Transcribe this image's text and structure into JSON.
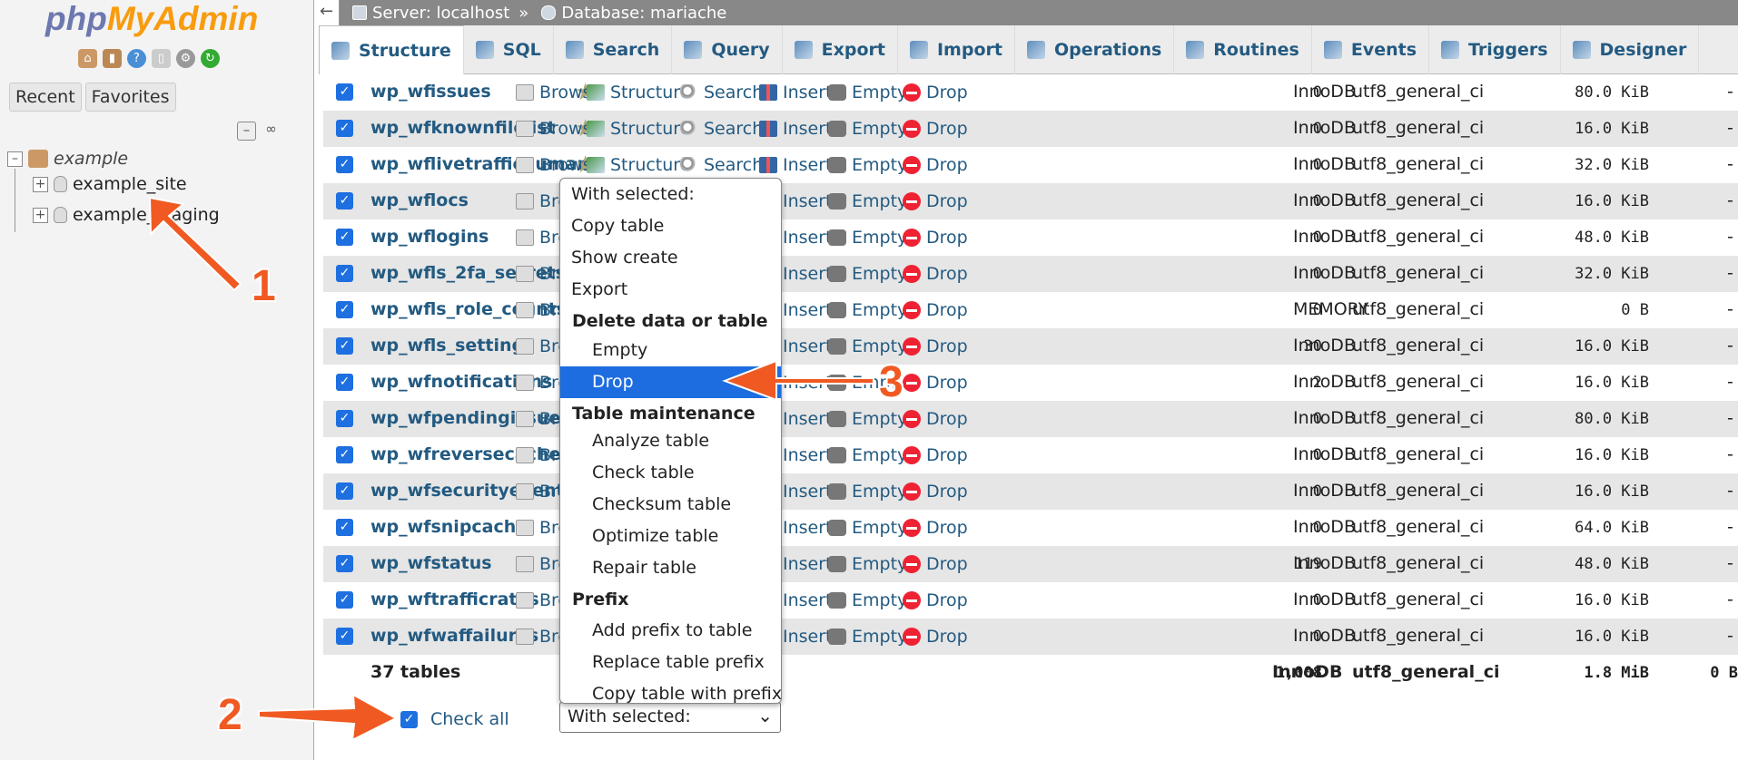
{
  "app": {
    "logo_main": "php",
    "logo_accent": "MyAdmin"
  },
  "left": {
    "tabs": [
      "Recent",
      "Favorites"
    ],
    "tree": {
      "root": "example",
      "children": [
        "example_site",
        "example_staging"
      ]
    }
  },
  "breadcrumb": {
    "back": "←",
    "server": "Server: localhost",
    "separator": "»",
    "database": "Database: mariache"
  },
  "menu": [
    "Structure",
    "SQL",
    "Search",
    "Query",
    "Export",
    "Import",
    "Operations",
    "Routines",
    "Events",
    "Triggers",
    "Designer"
  ],
  "actions": {
    "browse": "Browse",
    "structure": "Structure",
    "search": "Search",
    "insert": "Insert",
    "empty": "Empty",
    "drop": "Drop"
  },
  "rows": [
    {
      "name": "wp_wfissues",
      "rows": "0",
      "engine": "InnoDB",
      "collation": "utf8_general_ci",
      "size": "80.0 KiB",
      "overhead": "-"
    },
    {
      "name": "wp_wfknownfilelist",
      "rows": "0",
      "engine": "InnoDB",
      "collation": "utf8_general_ci",
      "size": "16.0 KiB",
      "overhead": "-"
    },
    {
      "name": "wp_wflivetraffichuman",
      "rows": "0",
      "engine": "InnoDB",
      "collation": "utf8_general_ci",
      "size": "32.0 KiB",
      "overhead": "-"
    },
    {
      "name": "wp_wflocs",
      "rows": "0",
      "engine": "InnoDB",
      "collation": "utf8_general_ci",
      "size": "16.0 KiB",
      "overhead": "-"
    },
    {
      "name": "wp_wflogins",
      "rows": "0",
      "engine": "InnoDB",
      "collation": "utf8_general_ci",
      "size": "48.0 KiB",
      "overhead": "-"
    },
    {
      "name": "wp_wfls_2fa_secrets",
      "rows": "0",
      "engine": "InnoDB",
      "collation": "utf8_general_ci",
      "size": "32.0 KiB",
      "overhead": "-"
    },
    {
      "name": "wp_wfls_role_counts",
      "rows": "0",
      "engine": "MEMORY",
      "collation": "utf8_general_ci",
      "size": "0 B",
      "overhead": "-"
    },
    {
      "name": "wp_wfls_settings",
      "rows": "30",
      "engine": "InnoDB",
      "collation": "utf8_general_ci",
      "size": "16.0 KiB",
      "overhead": "-"
    },
    {
      "name": "wp_wfnotifications",
      "rows": "2",
      "engine": "InnoDB",
      "collation": "utf8_general_ci",
      "size": "16.0 KiB",
      "overhead": "-"
    },
    {
      "name": "wp_wfpendingissues",
      "rows": "0",
      "engine": "InnoDB",
      "collation": "utf8_general_ci",
      "size": "80.0 KiB",
      "overhead": "-"
    },
    {
      "name": "wp_wfreversecache",
      "rows": "0",
      "engine": "InnoDB",
      "collation": "utf8_general_ci",
      "size": "16.0 KiB",
      "overhead": "-"
    },
    {
      "name": "wp_wfsecurityevents",
      "rows": "0",
      "engine": "InnoDB",
      "collation": "utf8_general_ci",
      "size": "16.0 KiB",
      "overhead": "-"
    },
    {
      "name": "wp_wfsnipcache",
      "rows": "0",
      "engine": "InnoDB",
      "collation": "utf8_general_ci",
      "size": "64.0 KiB",
      "overhead": "-"
    },
    {
      "name": "wp_wfstatus",
      "rows": "119",
      "engine": "InnoDB",
      "collation": "utf8_general_ci",
      "size": "48.0 KiB",
      "overhead": "-"
    },
    {
      "name": "wp_wftrafficrates",
      "rows": "0",
      "engine": "InnoDB",
      "collation": "utf8_general_ci",
      "size": "16.0 KiB",
      "overhead": "-"
    },
    {
      "name": "wp_wfwaffailures",
      "rows": "0",
      "engine": "InnoDB",
      "collation": "utf8_general_ci",
      "size": "16.0 KiB",
      "overhead": "-"
    }
  ],
  "summary": {
    "tables": "37 tables",
    "rows": "1,008",
    "engine": "InnoDB",
    "collation": "utf8_general_ci",
    "size": "1.8 MiB",
    "overhead": "0 B"
  },
  "check_all": "Check all",
  "with_selected": "With selected:",
  "dropdown": [
    {
      "label": "With selected:",
      "kind": "item"
    },
    {
      "label": "Copy table",
      "kind": "item"
    },
    {
      "label": "Show create",
      "kind": "item"
    },
    {
      "label": "Export",
      "kind": "item"
    },
    {
      "label": "Delete data or table",
      "kind": "group"
    },
    {
      "label": "Empty",
      "kind": "sub"
    },
    {
      "label": "Drop",
      "kind": "selected"
    },
    {
      "label": "Table maintenance",
      "kind": "group"
    },
    {
      "label": "Analyze table",
      "kind": "sub"
    },
    {
      "label": "Check table",
      "kind": "sub"
    },
    {
      "label": "Checksum table",
      "kind": "sub"
    },
    {
      "label": "Optimize table",
      "kind": "sub"
    },
    {
      "label": "Repair table",
      "kind": "sub"
    },
    {
      "label": "Prefix",
      "kind": "group"
    },
    {
      "label": "Add prefix to table",
      "kind": "sub"
    },
    {
      "label": "Replace table prefix",
      "kind": "sub"
    },
    {
      "label": "Copy table with prefix",
      "kind": "sub"
    }
  ],
  "annotations": {
    "one": "1",
    "two": "2",
    "three": "3",
    "color": "#f05a22"
  }
}
